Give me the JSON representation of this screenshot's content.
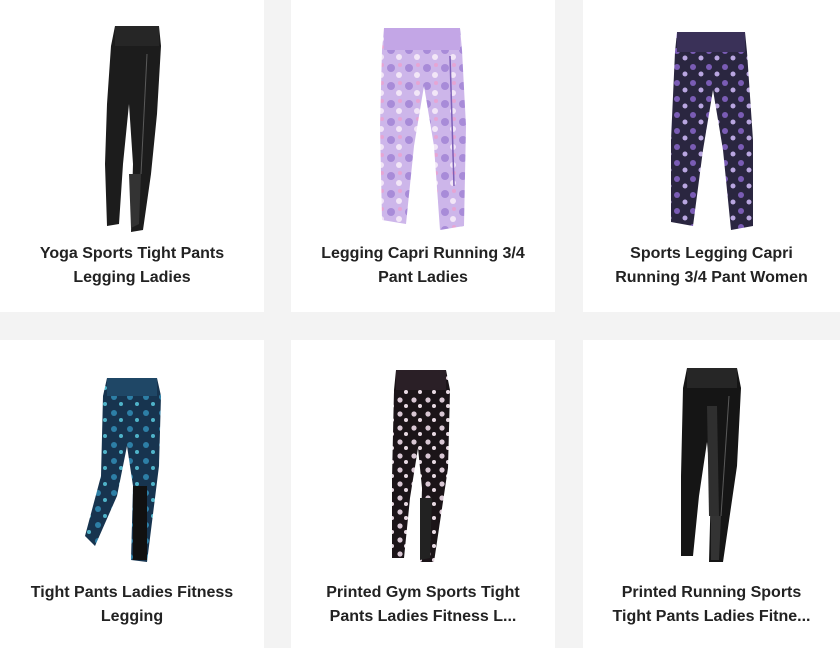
{
  "products": [
    {
      "title": "Yoga Sports Tight Pants\nLegging Ladies",
      "image_icon": "black-leggings-icon",
      "colors": [
        "#1a1a1a",
        "#2b2b2b",
        "#444444"
      ]
    },
    {
      "title": "Legging Capri Running 3/4\nPant Ladies",
      "image_icon": "purple-capri-leggings-icon",
      "colors": [
        "#cdb6ea",
        "#9f7fd1",
        "#f0e2f6"
      ]
    },
    {
      "title": "Sports Legging Capri\nRunning 3/4 Pant Women",
      "image_icon": "dark-purple-capri-leggings-icon",
      "colors": [
        "#2a2640",
        "#7a5cb5",
        "#b9a6e0"
      ]
    },
    {
      "title": "Tight Pants Ladies Fitness\nLegging",
      "image_icon": "blue-print-leggings-icon",
      "colors": [
        "#17344f",
        "#2d7fa6",
        "#111111"
      ]
    },
    {
      "title": "Printed Gym Sports Tight\nPants Ladies Fitness L...",
      "image_icon": "floral-print-leggings-icon",
      "colors": [
        "#1b1418",
        "#d9c7d4",
        "#222222"
      ]
    },
    {
      "title": "Printed Running Sports\nTight Pants Ladies Fitne...",
      "image_icon": "black-print-leggings-icon",
      "colors": [
        "#111111",
        "#2a2a2a",
        "#3a3a3a"
      ]
    }
  ]
}
